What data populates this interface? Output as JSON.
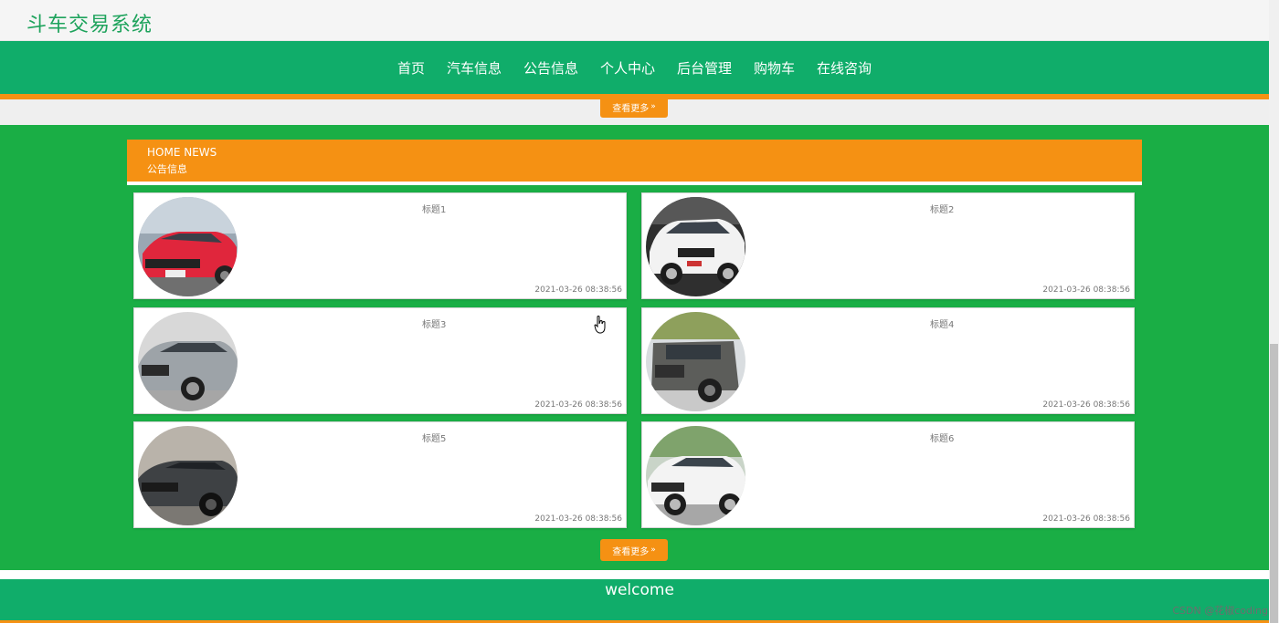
{
  "header": {
    "app_title": "斗车交易系统"
  },
  "nav": {
    "items": [
      "首页",
      "汽车信息",
      "公告信息",
      "个人中心",
      "后台管理",
      "购物车",
      "在线咨询"
    ]
  },
  "more_button": {
    "label": "查看更多",
    "arrow": "»"
  },
  "news_section": {
    "title_en": "HOME NEWS",
    "title_cn": "公告信息",
    "cards": [
      {
        "title": "标题1",
        "time": "2021-03-26 08:38:56",
        "image": "red-sedan"
      },
      {
        "title": "标题2",
        "time": "2021-03-26 08:38:56",
        "image": "white-suv"
      },
      {
        "title": "标题3",
        "time": "2021-03-26 08:38:56",
        "image": "silver-suv"
      },
      {
        "title": "标题4",
        "time": "2021-03-26 08:38:56",
        "image": "grey-offroad"
      },
      {
        "title": "标题5",
        "time": "2021-03-26 08:38:56",
        "image": "dark-muscle-car"
      },
      {
        "title": "标题6",
        "time": "2021-03-26 08:38:56",
        "image": "white-crossover"
      }
    ]
  },
  "footer": {
    "text": "welcome"
  },
  "watermark": "CSDN @花椒coding",
  "colors": {
    "nav_green": "#10ad6a",
    "section_green": "#1aae45",
    "accent_orange": "#f59113",
    "title_green": "#1ea35c"
  }
}
